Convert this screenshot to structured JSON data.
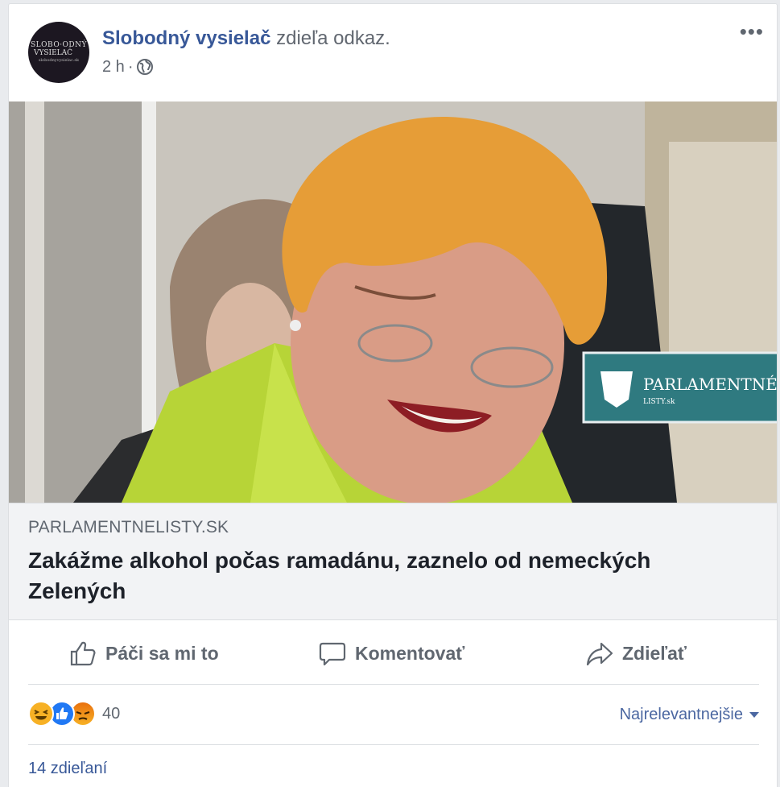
{
  "post": {
    "author": "Slobodný vysielač",
    "action_text": "zdieľa odkaz.",
    "time": "2 h",
    "separator": "·",
    "privacy_icon": "globe-icon",
    "more_icon": "more-options-icon",
    "more_label": "•••"
  },
  "avatar": {
    "line1": "SLOBO·ODNÝ",
    "line2": "VYSIELAČ",
    "line3": "slobodnyvysielac.sk"
  },
  "link": {
    "image_watermark": "PARLAMENTNÉ",
    "image_watermark_sub": "LISTY.sk",
    "domain": "PARLAMENTNELISTY.SK",
    "title": "Zakážme alkohol počas ramadánu, zaznelo od nemeckých Zelených"
  },
  "actions": {
    "like": "Páči sa mi to",
    "comment": "Komentovať",
    "share": "Zdieľať"
  },
  "reactions": {
    "icons": [
      "haha-icon",
      "like-icon",
      "angry-icon"
    ],
    "count": "40",
    "sort_label": "Najrelevantnejšie"
  },
  "shares": "14 zdieľaní",
  "colors": {
    "link_blue": "#385898",
    "like_blue": "#2078f4",
    "haha_yellow": "#f7b125",
    "angry_orange": "#e9710f"
  }
}
